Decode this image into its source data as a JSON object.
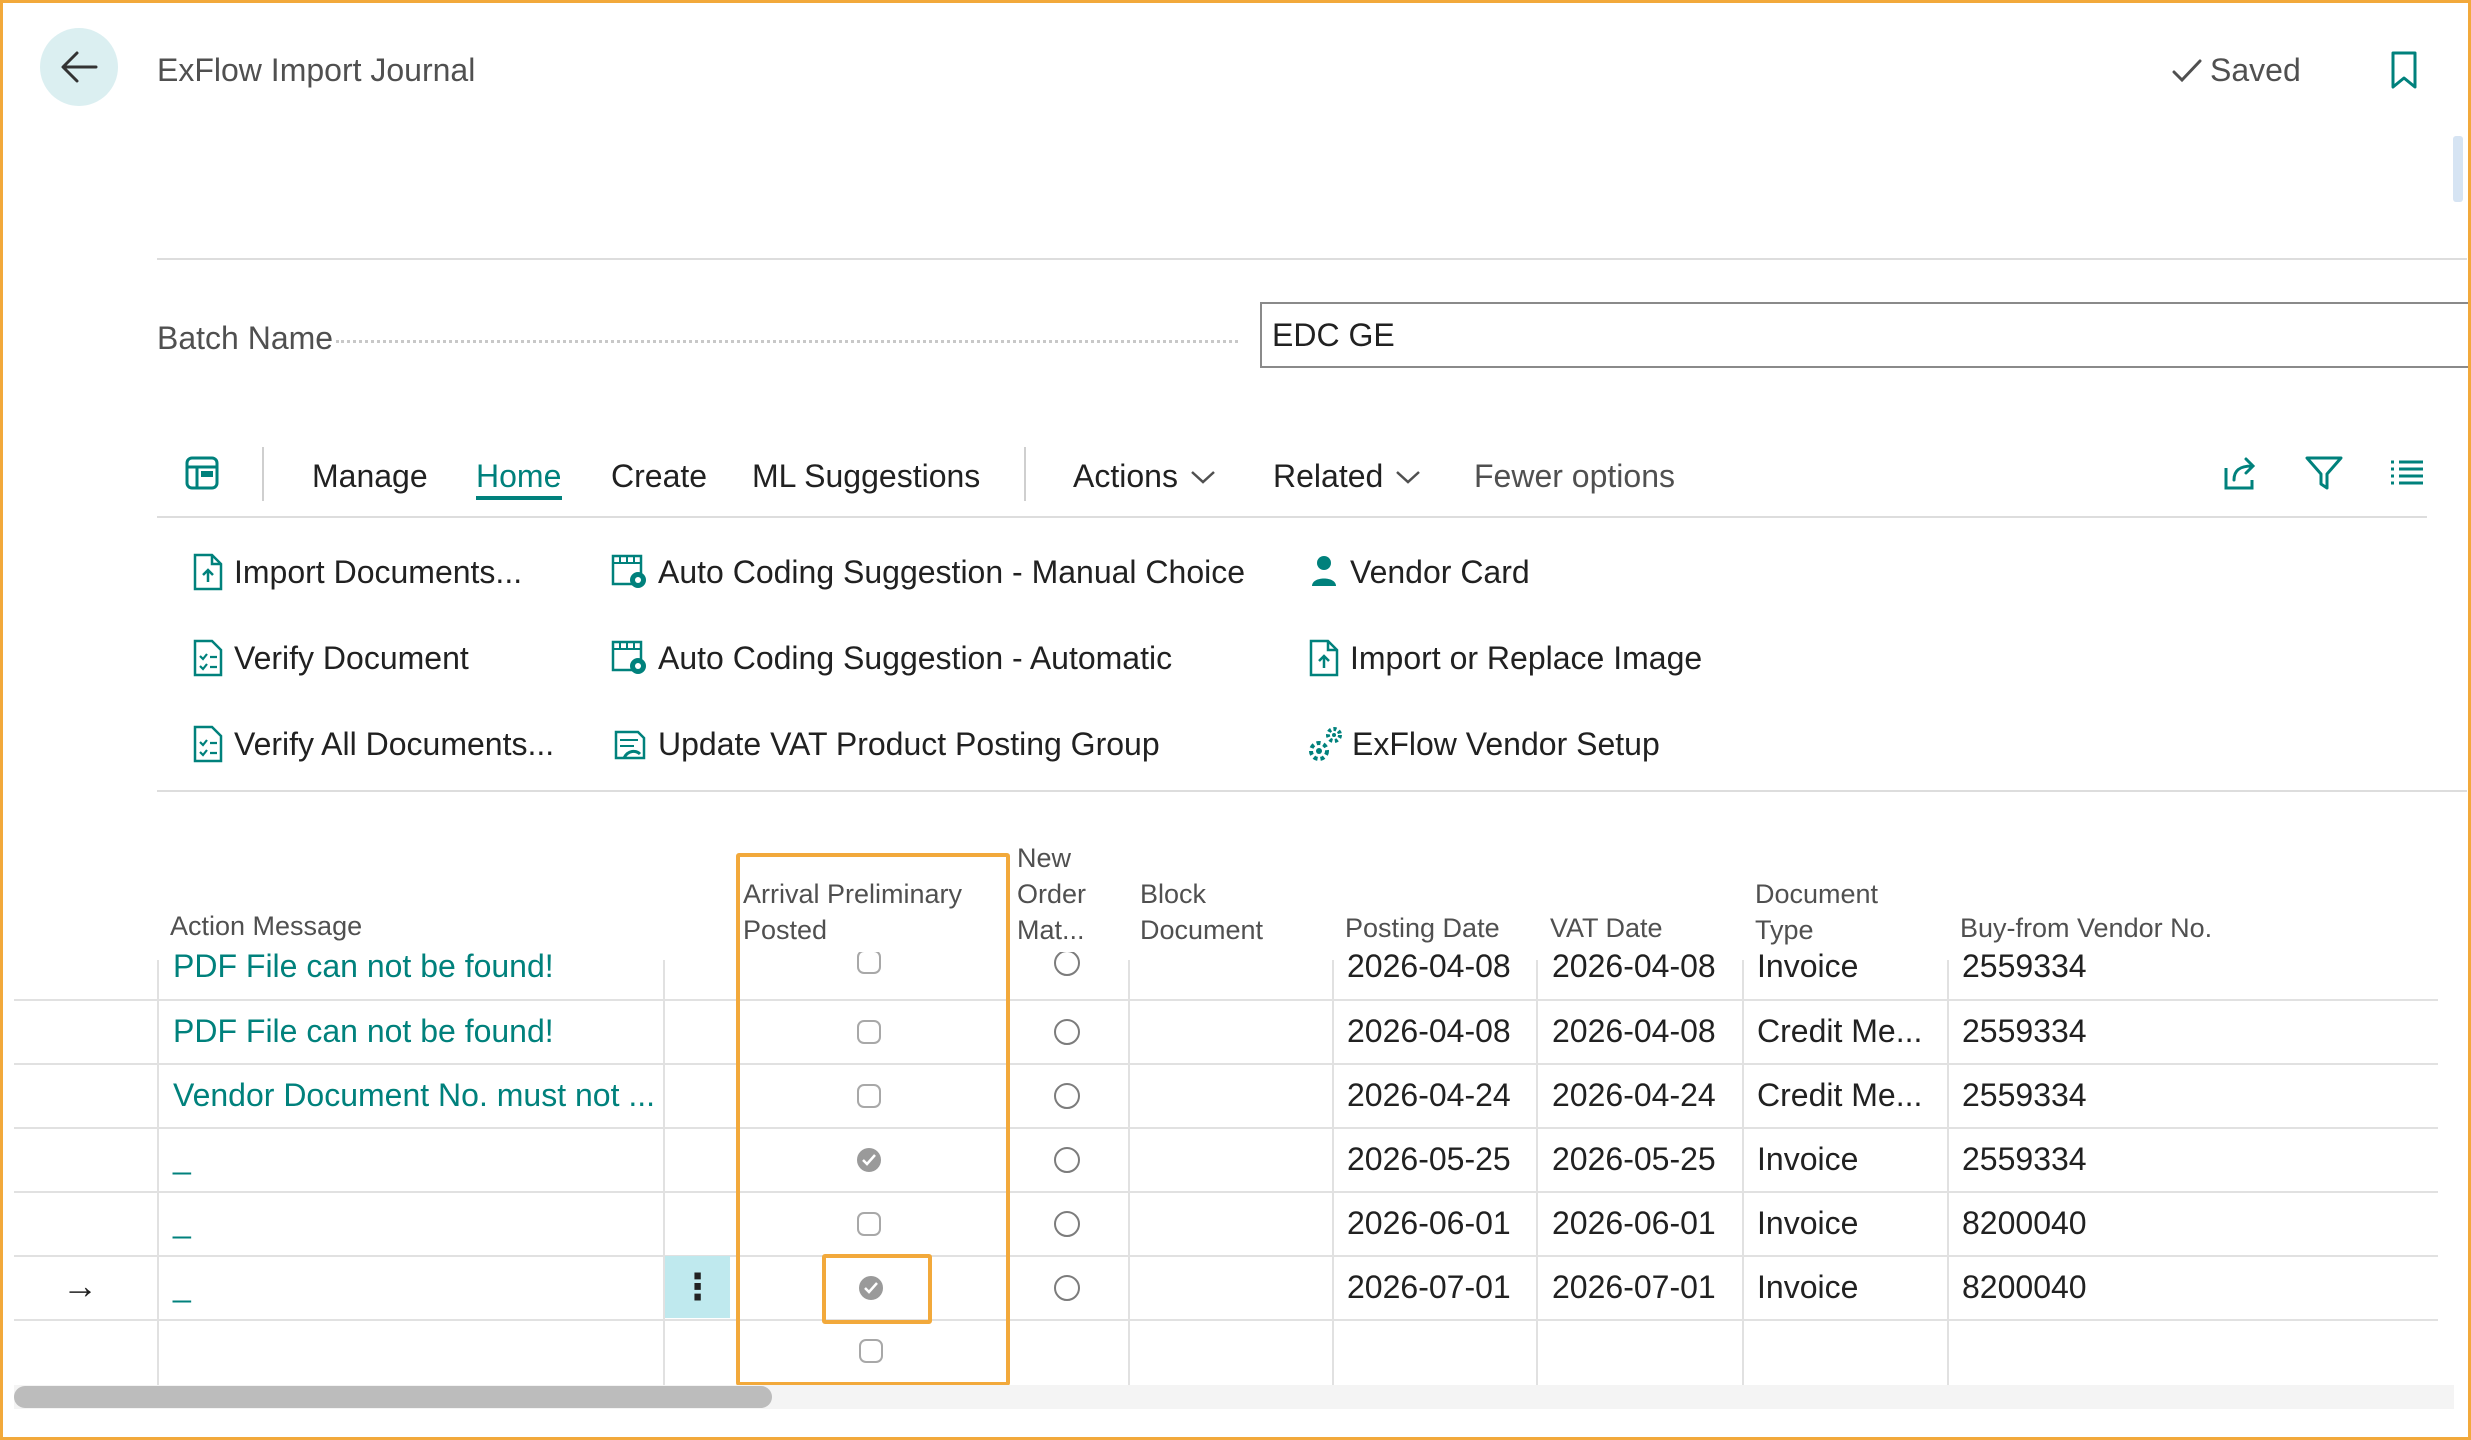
{
  "header": {
    "title": "ExFlow Import Journal",
    "saved_label": "Saved"
  },
  "batch": {
    "label": "Batch Name",
    "value": "EDC GE"
  },
  "toolbar": {
    "tabs": [
      "Manage",
      "Home",
      "Create",
      "ML Suggestions"
    ],
    "active_tab": "Home",
    "actions_label": "Actions",
    "related_label": "Related",
    "fewer_label": "Fewer options"
  },
  "actions": {
    "col1": [
      "Import Documents...",
      "Verify Document",
      "Verify All Documents..."
    ],
    "col2": [
      "Auto Coding Suggestion - Manual Choice",
      "Auto Coding Suggestion - Automatic",
      "Update VAT Product Posting Group"
    ],
    "col3": [
      "Vendor Card",
      "Import or Replace Image",
      "ExFlow Vendor Setup"
    ]
  },
  "table": {
    "headers": {
      "action_message": "Action Message",
      "arrival_1": "Arrival Preliminary",
      "arrival_2": "Posted",
      "new_order_1": "New",
      "new_order_2": "Order",
      "new_order_3": "Mat...",
      "block_1": "Block",
      "block_2": "Document",
      "posting_date": "Posting Date",
      "vat_date": "VAT Date",
      "doc_type_1": "Document",
      "doc_type_2": "Type",
      "vendor_no": "Buy-from Vendor No."
    },
    "rows": [
      {
        "message": "PDF File can not be found!",
        "arrival": false,
        "posting_date": "2026-04-08",
        "vat_date": "2026-04-08",
        "doc_type": "Invoice",
        "vendor": "2559334"
      },
      {
        "message": "PDF File can not be found!",
        "arrival": false,
        "posting_date": "2026-04-08",
        "vat_date": "2026-04-08",
        "doc_type": "Credit Me...",
        "vendor": "2559334"
      },
      {
        "message": "Vendor Document No. must not ...",
        "arrival": false,
        "posting_date": "2026-04-24",
        "vat_date": "2026-04-24",
        "doc_type": "Credit Me...",
        "vendor": "2559334"
      },
      {
        "message": "_",
        "arrival": true,
        "posting_date": "2026-05-25",
        "vat_date": "2026-05-25",
        "doc_type": "Invoice",
        "vendor": "2559334"
      },
      {
        "message": "_",
        "arrival": false,
        "posting_date": "2026-06-01",
        "vat_date": "2026-06-01",
        "doc_type": "Invoice",
        "vendor": "8200040"
      },
      {
        "message": "_",
        "arrival": true,
        "posting_date": "2026-07-01",
        "vat_date": "2026-07-01",
        "doc_type": "Invoice",
        "vendor": "8200040"
      }
    ],
    "selected_row_marker": "→",
    "row_menu": "⋮"
  },
  "colors": {
    "accent": "#00817c",
    "highlight": "#f2a93b",
    "selected_bg": "#bfe9ee"
  },
  "icons": [
    "back-arrow-icon",
    "checkmark-icon",
    "bookmark-icon",
    "page-layout-icon",
    "chevron-down-icon",
    "share-icon",
    "filter-icon",
    "list-icon",
    "document-import-icon",
    "document-check-icon",
    "auto-coding-icon",
    "person-icon",
    "image-import-icon",
    "settings-icon"
  ]
}
